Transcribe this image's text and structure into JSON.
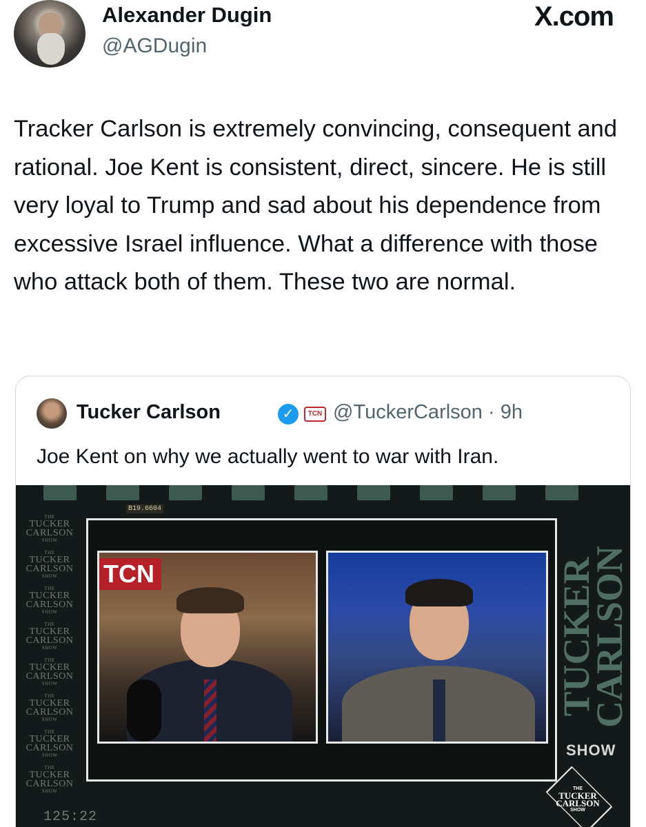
{
  "header": {
    "name": "Alexander Dugin",
    "handle": "@AGDugin",
    "brand": "X.com"
  },
  "tweet": {
    "text": "Tracker Carlson is extremely convincing, consequent and rational. Joe Kent is consistent, direct, sincere. He is still very loyal to Trump and sad about his dependence from excessive Israel influence. What a difference with those who attack both of them. These two are normal."
  },
  "quote": {
    "name": "Tucker Carlson",
    "verified_icon": "✓",
    "affiliate_badge": "TCN",
    "handle_time": "@TuckerCarlson · 9h",
    "text": "Joe Kent on why we actually went to war with Iran."
  },
  "video": {
    "timecode_top": "B19.6604",
    "timecode_bottom": "125:22",
    "watermark_small": "THE",
    "watermark_line1": "TUCKER",
    "watermark_line2": "CARLSON",
    "watermark_show": "SHOW",
    "side_logo_line1": "TUCKER",
    "side_logo_line2": "CARLSON",
    "side_logo_show": "SHOW",
    "left_sign": "TCN",
    "corner_the": "THE",
    "corner_l1": "TUCKER",
    "corner_l2": "CARLSON",
    "corner_show": "SHOW"
  }
}
